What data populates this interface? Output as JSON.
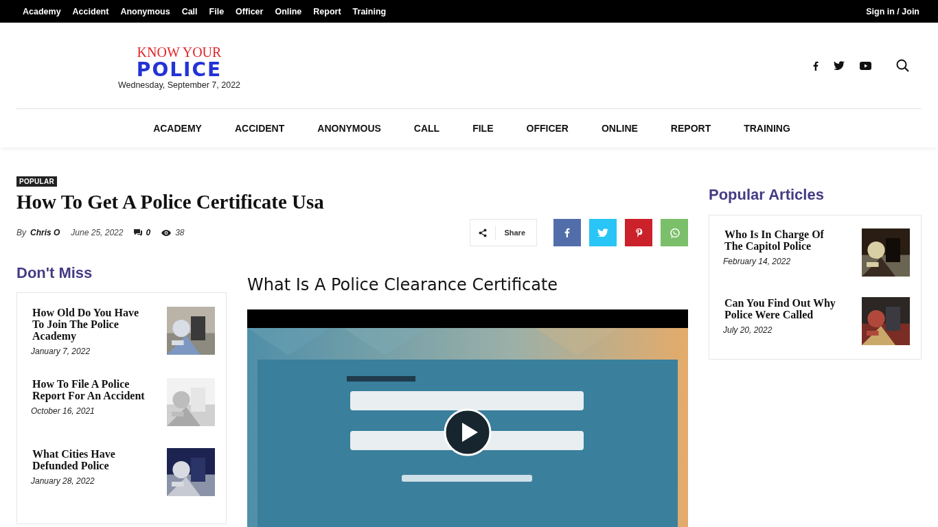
{
  "top_bar": {
    "links": [
      "Academy",
      "Accident",
      "Anonymous",
      "Call",
      "File",
      "Officer",
      "Online",
      "Report",
      "Training"
    ],
    "sign_in": "Sign in / Join"
  },
  "header": {
    "logo_top": "KNOW YOUR",
    "logo_bottom": "POLICE",
    "date": "Wednesday, September 7, 2022"
  },
  "main_nav": {
    "items": [
      "ACADEMY",
      "ACCIDENT",
      "ANONYMOUS",
      "CALL",
      "FILE",
      "OFFICER",
      "ONLINE",
      "REPORT",
      "TRAINING"
    ]
  },
  "article": {
    "category": "POPULAR",
    "title": "How To Get A Police Certificate Usa",
    "by": "By",
    "author": "Chris O",
    "date": "June 25, 2022",
    "comments": "0",
    "views": "38",
    "share_label": "Share",
    "share_buttons": [
      {
        "kind": "facebook",
        "color": "#516eab"
      },
      {
        "kind": "twitter",
        "color": "#29c5f6"
      },
      {
        "kind": "pinterest",
        "color": "#ca212a"
      },
      {
        "kind": "whatsapp",
        "color": "#7bbf6a"
      }
    ]
  },
  "dont_miss": {
    "title": "Don't Miss",
    "posts": [
      {
        "title": "How Old Do You Have To Join The Police Academy",
        "date": "January 7, 2022"
      },
      {
        "title": "How To File A Police Report For An Accident",
        "date": "October 16, 2021"
      },
      {
        "title": "What Cities Have Defunded Police",
        "date": "January 28, 2022"
      }
    ]
  },
  "content": {
    "heading": "What Is A Police Clearance Certificate"
  },
  "sidebar": {
    "title": "Popular Articles",
    "posts": [
      {
        "title": "Who Is In Charge Of The Capitol Police",
        "date": "February 14, 2022"
      },
      {
        "title": "Can You Find Out Why Police Were Called",
        "date": "July 20, 2022"
      }
    ]
  }
}
